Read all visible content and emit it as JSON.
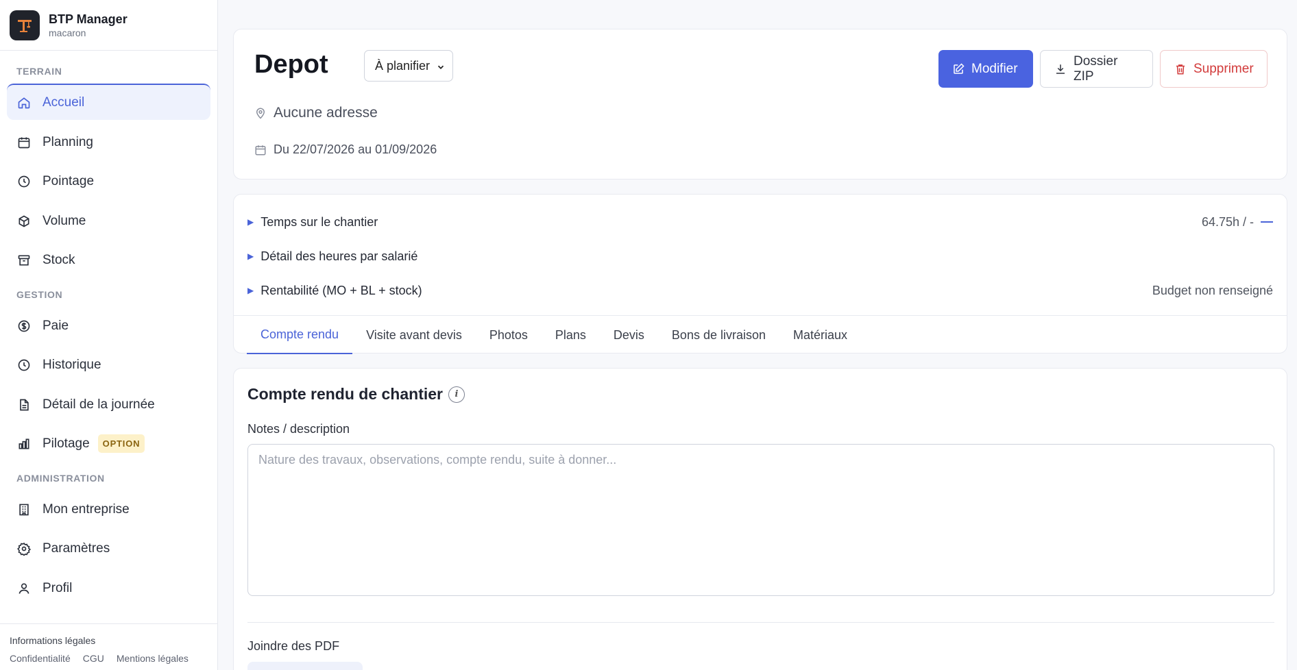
{
  "brand": {
    "name": "BTP Manager",
    "subtitle": "macaron",
    "icon": "crane-icon"
  },
  "sidebar": {
    "sections": [
      {
        "title": "TERRAIN"
      },
      {
        "title": "GESTION"
      },
      {
        "title": "ADMINISTRATION"
      }
    ],
    "items": [
      {
        "label": "Accueil",
        "icon": "home-icon",
        "active": true
      },
      {
        "label": "Planning",
        "icon": "calendar-icon"
      },
      {
        "label": "Pointage",
        "icon": "clock-icon"
      },
      {
        "label": "Volume",
        "icon": "cube-icon"
      },
      {
        "label": "Stock",
        "icon": "archive-icon"
      },
      {
        "label": "Paie",
        "icon": "dollar-icon"
      },
      {
        "label": "Historique",
        "icon": "history-icon"
      },
      {
        "label": "Détail de la journée",
        "icon": "document-icon"
      },
      {
        "label": "Pilotage",
        "icon": "bar-chart-icon",
        "badge": "OPTION"
      },
      {
        "label": "Mon entreprise",
        "icon": "building-icon"
      },
      {
        "label": "Paramètres",
        "icon": "gear-icon"
      },
      {
        "label": "Profil",
        "icon": "user-icon"
      }
    ],
    "footer": {
      "title": "Informations légales",
      "links": [
        "Confidentialité",
        "CGU",
        "Mentions légales"
      ]
    }
  },
  "header": {
    "title": "Depot",
    "status": "À planifier",
    "actions": {
      "edit": "Modifier",
      "zip": "Dossier ZIP",
      "delete": "Supprimer"
    },
    "address": "Aucune adresse",
    "dates": "Du 22/07/2026 au 01/09/2026"
  },
  "accordion": [
    {
      "label": "Temps sur le chantier",
      "value": "64.75h / -"
    },
    {
      "label": "Détail des heures par salarié",
      "value": ""
    },
    {
      "label": "Rentabilité (MO + BL + stock)",
      "value": "Budget non renseigné"
    }
  ],
  "tabs": [
    "Compte rendu",
    "Visite avant devis",
    "Photos",
    "Plans",
    "Devis",
    "Bons de livraison",
    "Matériaux"
  ],
  "report": {
    "title": "Compte rendu de chantier",
    "info": "i",
    "notes_label": "Notes / description",
    "notes_placeholder": "Nature des travaux, observations, compte rendu, suite à donner...",
    "notes_value": "",
    "pdf_label": "Joindre des PDF"
  },
  "colors": {
    "accent": "#4a63e0",
    "danger": "#d23a3a",
    "option_badge_bg": "#fdf1c9"
  }
}
